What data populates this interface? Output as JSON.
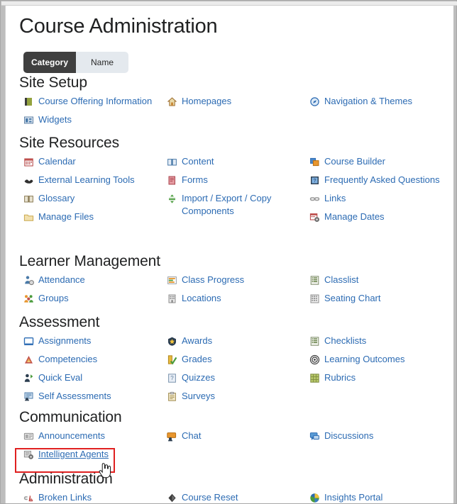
{
  "window": {
    "title": "Course Administration"
  },
  "header": {
    "title": "Course Administration"
  },
  "toggle": {
    "name": "sort-toggle",
    "options": [
      {
        "label": "Category",
        "selected": true
      },
      {
        "label": "Name",
        "selected": false
      }
    ],
    "active_bg": "#3f3f3f",
    "inactive_bg": "#e4e9ee"
  },
  "link_color": "#2c6bb3",
  "highlight": {
    "color": "#e02020",
    "target_label": "Intelligent Agents",
    "cursor": "pointing-hand"
  },
  "sections": [
    {
      "id": "site-setup",
      "title": "Site Setup",
      "columns": [
        [
          {
            "label": "Course Offering Information",
            "icon": "course-offering-information-icon"
          },
          {
            "label": "Widgets",
            "icon": "widgets-icon"
          }
        ],
        [
          {
            "label": "Homepages",
            "icon": "homepages-icon"
          }
        ],
        [
          {
            "label": "Navigation & Themes",
            "icon": "navigation-themes-icon"
          }
        ]
      ]
    },
    {
      "id": "site-resources",
      "title": "Site Resources",
      "columns": [
        [
          {
            "label": "Calendar",
            "icon": "calendar-icon"
          },
          {
            "label": "External Learning Tools",
            "icon": "external-learning-tools-icon"
          },
          {
            "label": "Glossary",
            "icon": "glossary-icon"
          },
          {
            "label": "Manage Files",
            "icon": "manage-files-icon"
          }
        ],
        [
          {
            "label": "Content",
            "icon": "content-icon"
          },
          {
            "label": "Forms",
            "icon": "forms-icon"
          },
          {
            "label": "Import / Export / Copy Components",
            "icon": "import-export-copy-icon"
          }
        ],
        [
          {
            "label": "Course Builder",
            "icon": "course-builder-icon"
          },
          {
            "label": "Frequently Asked Questions",
            "icon": "faq-icon"
          },
          {
            "label": "Links",
            "icon": "links-icon"
          },
          {
            "label": "Manage Dates",
            "icon": "manage-dates-icon"
          }
        ]
      ]
    },
    {
      "id": "learner-management",
      "title": "Learner Management",
      "columns": [
        [
          {
            "label": "Attendance",
            "icon": "attendance-icon"
          },
          {
            "label": "Groups",
            "icon": "groups-icon"
          }
        ],
        [
          {
            "label": "Class Progress",
            "icon": "class-progress-icon"
          },
          {
            "label": "Locations",
            "icon": "locations-icon"
          }
        ],
        [
          {
            "label": "Classlist",
            "icon": "classlist-icon"
          },
          {
            "label": "Seating Chart",
            "icon": "seating-chart-icon"
          }
        ]
      ]
    },
    {
      "id": "assessment",
      "title": "Assessment",
      "columns": [
        [
          {
            "label": "Assignments",
            "icon": "assignments-icon"
          },
          {
            "label": "Competencies",
            "icon": "competencies-icon"
          },
          {
            "label": "Quick Eval",
            "icon": "quick-eval-icon"
          },
          {
            "label": "Self Assessments",
            "icon": "self-assessments-icon"
          }
        ],
        [
          {
            "label": "Awards",
            "icon": "awards-icon"
          },
          {
            "label": "Grades",
            "icon": "grades-icon"
          },
          {
            "label": "Quizzes",
            "icon": "quizzes-icon"
          },
          {
            "label": "Surveys",
            "icon": "surveys-icon"
          }
        ],
        [
          {
            "label": "Checklists",
            "icon": "checklists-icon"
          },
          {
            "label": "Learning Outcomes",
            "icon": "learning-outcomes-icon"
          },
          {
            "label": "Rubrics",
            "icon": "rubrics-icon"
          }
        ]
      ]
    },
    {
      "id": "communication",
      "title": "Communication",
      "columns": [
        [
          {
            "label": "Announcements",
            "icon": "announcements-icon"
          },
          {
            "label": "Intelligent Agents",
            "icon": "intelligent-agents-icon",
            "highlighted": true
          }
        ],
        [
          {
            "label": "Chat",
            "icon": "chat-icon"
          }
        ],
        [
          {
            "label": "Discussions",
            "icon": "discussions-icon"
          }
        ]
      ]
    },
    {
      "id": "administration",
      "title": "Administration",
      "columns": [
        [
          {
            "label": "Broken Links",
            "icon": "broken-links-icon"
          }
        ],
        [
          {
            "label": "Course Reset",
            "icon": "course-reset-icon"
          }
        ],
        [
          {
            "label": "Insights Portal",
            "icon": "insights-portal-icon"
          }
        ]
      ]
    }
  ]
}
